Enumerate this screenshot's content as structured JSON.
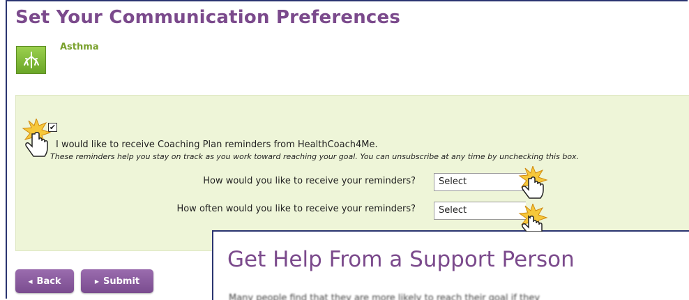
{
  "header": {
    "title": "Set Your Communication Preferences"
  },
  "topic": {
    "label": "Asthma",
    "icon": "lungs-icon"
  },
  "reminders": {
    "checkbox_checked": true,
    "checkbox_mark": "✔",
    "optin_text": "I would like to receive Coaching Plan reminders from HealthCoach4Me.",
    "note": "These reminders help you stay on track as you work toward reaching your goal. You can unsubscribe at any time by unchecking this box.",
    "method_question": "How would you like to receive your reminders?",
    "method_value": "Select",
    "frequency_question": "How often would you like to receive your reminders?",
    "frequency_value": "Select"
  },
  "buttons": {
    "back": "Back",
    "submit": "Submit"
  },
  "overlay": {
    "title": "Get Help From a Support Person",
    "body": "Many people find that they are more likely to reach their goal if they"
  },
  "colors": {
    "title": "#7b4a8c",
    "panel": "#eef5d8",
    "accent_green": "#7aa12d",
    "button": "#8a5c9f"
  }
}
